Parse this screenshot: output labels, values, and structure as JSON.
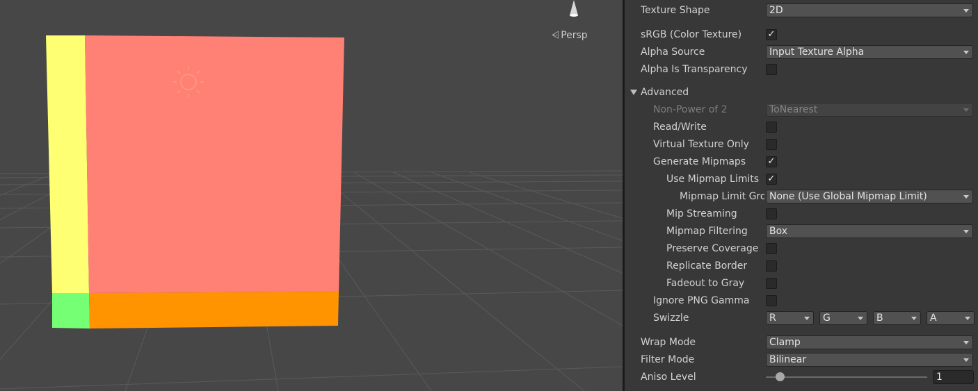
{
  "scene": {
    "view_label": "Persp",
    "colors": {
      "background": "#474747",
      "grid": "#5a5a5a",
      "quad_main": "#ff8074",
      "quad_left": "#ffff74",
      "quad_bottom_left": "#74ff74",
      "quad_bottom": "#ff9300",
      "sun_icon": "#ff9b80"
    },
    "icons": [
      "light-icon",
      "camera-gizmo-icon",
      "persp-arrow-icon"
    ]
  },
  "inspector": {
    "texture_shape": {
      "label": "Texture Shape",
      "value": "2D"
    },
    "srgb": {
      "label": "sRGB (Color Texture)",
      "checked": "✓"
    },
    "alpha_source": {
      "label": "Alpha Source",
      "value": "Input Texture Alpha"
    },
    "alpha_is_transparency": {
      "label": "Alpha Is Transparency",
      "checked": ""
    },
    "advanced": {
      "label": "Advanced",
      "non_power_of_2": {
        "label": "Non-Power of 2",
        "value": "ToNearest"
      },
      "read_write": {
        "label": "Read/Write",
        "checked": ""
      },
      "virtual_texture_only": {
        "label": "Virtual Texture Only",
        "checked": ""
      },
      "generate_mipmaps": {
        "label": "Generate Mipmaps",
        "checked": "✓"
      },
      "use_mipmap_limits": {
        "label": "Use Mipmap Limits",
        "checked": "✓"
      },
      "mipmap_limit_group": {
        "label": "Mipmap Limit Gro",
        "value": "None (Use Global Mipmap Limit)"
      },
      "mip_streaming": {
        "label": "Mip Streaming",
        "checked": ""
      },
      "mipmap_filtering": {
        "label": "Mipmap Filtering",
        "value": "Box"
      },
      "preserve_coverage": {
        "label": "Preserve Coverage",
        "checked": ""
      },
      "replicate_border": {
        "label": "Replicate Border",
        "checked": ""
      },
      "fadeout_to_gray": {
        "label": "Fadeout to Gray",
        "checked": ""
      },
      "ignore_png_gamma": {
        "label": "Ignore PNG Gamma",
        "checked": ""
      },
      "swizzle": {
        "label": "Swizzle",
        "channels": [
          "R",
          "G",
          "B",
          "A"
        ]
      }
    },
    "wrap_mode": {
      "label": "Wrap Mode",
      "value": "Clamp"
    },
    "filter_mode": {
      "label": "Filter Mode",
      "value": "Bilinear"
    },
    "aniso_level": {
      "label": "Aniso Level",
      "value": "1",
      "slider_fraction": 0.06
    }
  }
}
